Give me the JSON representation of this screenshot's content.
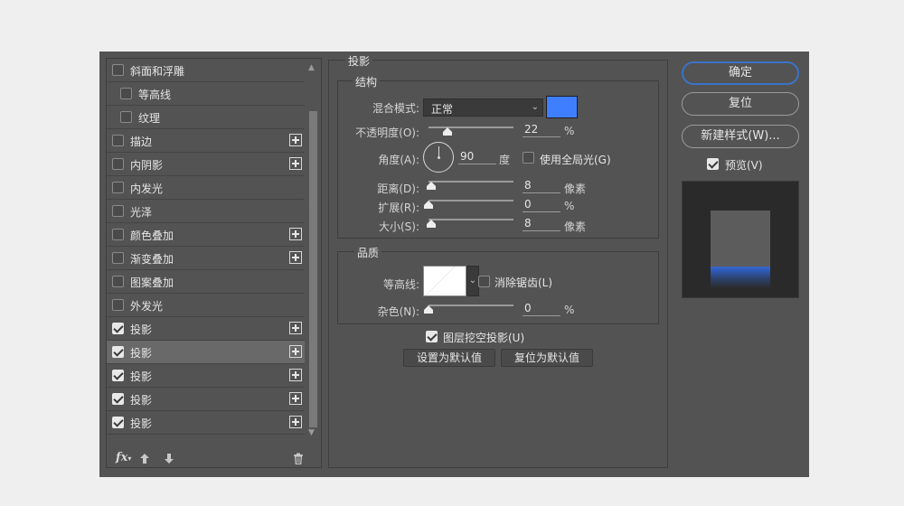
{
  "style_list": {
    "items": [
      {
        "label": "斜面和浮雕",
        "checked": false,
        "indent": false,
        "plus": false,
        "selected": false
      },
      {
        "label": "等高线",
        "checked": false,
        "indent": true,
        "plus": false,
        "selected": false
      },
      {
        "label": "纹理",
        "checked": false,
        "indent": true,
        "plus": false,
        "selected": false
      },
      {
        "label": "描边",
        "checked": false,
        "indent": false,
        "plus": true,
        "selected": false
      },
      {
        "label": "内阴影",
        "checked": false,
        "indent": false,
        "plus": true,
        "selected": false
      },
      {
        "label": "内发光",
        "checked": false,
        "indent": false,
        "plus": false,
        "selected": false
      },
      {
        "label": "光泽",
        "checked": false,
        "indent": false,
        "plus": false,
        "selected": false
      },
      {
        "label": "颜色叠加",
        "checked": false,
        "indent": false,
        "plus": true,
        "selected": false
      },
      {
        "label": "渐变叠加",
        "checked": false,
        "indent": false,
        "plus": true,
        "selected": false
      },
      {
        "label": "图案叠加",
        "checked": false,
        "indent": false,
        "plus": false,
        "selected": false
      },
      {
        "label": "外发光",
        "checked": false,
        "indent": false,
        "plus": false,
        "selected": false
      },
      {
        "label": "投影",
        "checked": true,
        "indent": false,
        "plus": true,
        "selected": false
      },
      {
        "label": "投影",
        "checked": true,
        "indent": false,
        "plus": true,
        "selected": true
      },
      {
        "label": "投影",
        "checked": true,
        "indent": false,
        "plus": true,
        "selected": false
      },
      {
        "label": "投影",
        "checked": true,
        "indent": false,
        "plus": true,
        "selected": false
      },
      {
        "label": "投影",
        "checked": true,
        "indent": false,
        "plus": true,
        "selected": false
      }
    ],
    "footer_fx": "fx"
  },
  "drop_shadow": {
    "title": "投影",
    "structure": {
      "title": "结构",
      "blend_mode_label": "混合模式:",
      "blend_mode_value": "正常",
      "shadow_color": "#3f7fff",
      "opacity_label": "不透明度(O):",
      "opacity_value": "22",
      "opacity_unit": "%",
      "opacity_slider": 0.22,
      "angle_label": "角度(A):",
      "angle_value": "90",
      "angle_unit": "度",
      "global_light_label": "使用全局光(G)",
      "global_light_checked": false,
      "distance_label": "距离(D):",
      "distance_value": "8",
      "distance_unit": "像素",
      "distance_slider": 0.03,
      "spread_label": "扩展(R):",
      "spread_value": "0",
      "spread_unit": "%",
      "spread_slider": 0,
      "size_label": "大小(S):",
      "size_value": "8",
      "size_unit": "像素",
      "size_slider": 0.03
    },
    "quality": {
      "title": "品质",
      "contour_label": "等高线:",
      "anti_alias_label": "消除锯齿(L)",
      "anti_alias_checked": false,
      "noise_label": "杂色(N):",
      "noise_value": "0",
      "noise_unit": "%",
      "noise_slider": 0
    },
    "knockout_label": "图层挖空投影(U)",
    "knockout_checked": true,
    "make_default_label": "设置为默认值",
    "reset_default_label": "复位为默认值"
  },
  "actions": {
    "ok_label": "确定",
    "reset_label": "复位",
    "new_style_label": "新建样式(W)...",
    "preview_label": "预览(V)",
    "preview_checked": true
  },
  "colors": {
    "dialog_bg": "#535353",
    "accent_blue": "#3b73c7",
    "shadow_blue": "#3f7fff"
  }
}
